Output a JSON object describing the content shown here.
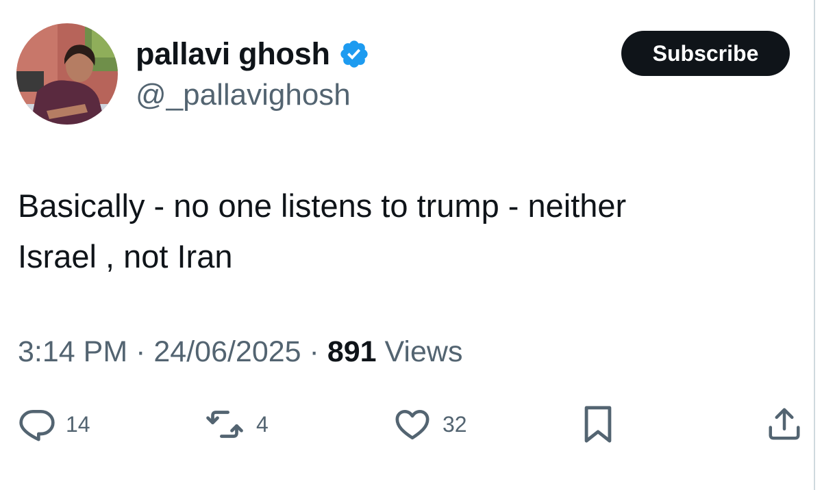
{
  "author": {
    "display_name": "pallavi ghosh",
    "handle": "@_pallavighosh",
    "verified": true
  },
  "header": {
    "subscribe_label": "Subscribe"
  },
  "tweet": {
    "text": "Basically - no one listens to trump - neither\nIsrael , not Iran",
    "time": "3:14 PM",
    "separator": "·",
    "date": "24/06/2025",
    "views_count": "891",
    "views_label": "Views"
  },
  "actions": {
    "replies": "14",
    "reposts": "4",
    "likes": "32"
  },
  "icons": {
    "verified": "verified-badge-icon",
    "reply": "reply-icon",
    "repost": "repost-icon",
    "like": "heart-icon",
    "bookmark": "bookmark-icon",
    "share": "share-icon"
  },
  "colors": {
    "text_primary": "#0f1419",
    "text_secondary": "#536471",
    "verified_blue": "#1d9bf0",
    "button_bg": "#0f1419",
    "button_text": "#ffffff"
  }
}
